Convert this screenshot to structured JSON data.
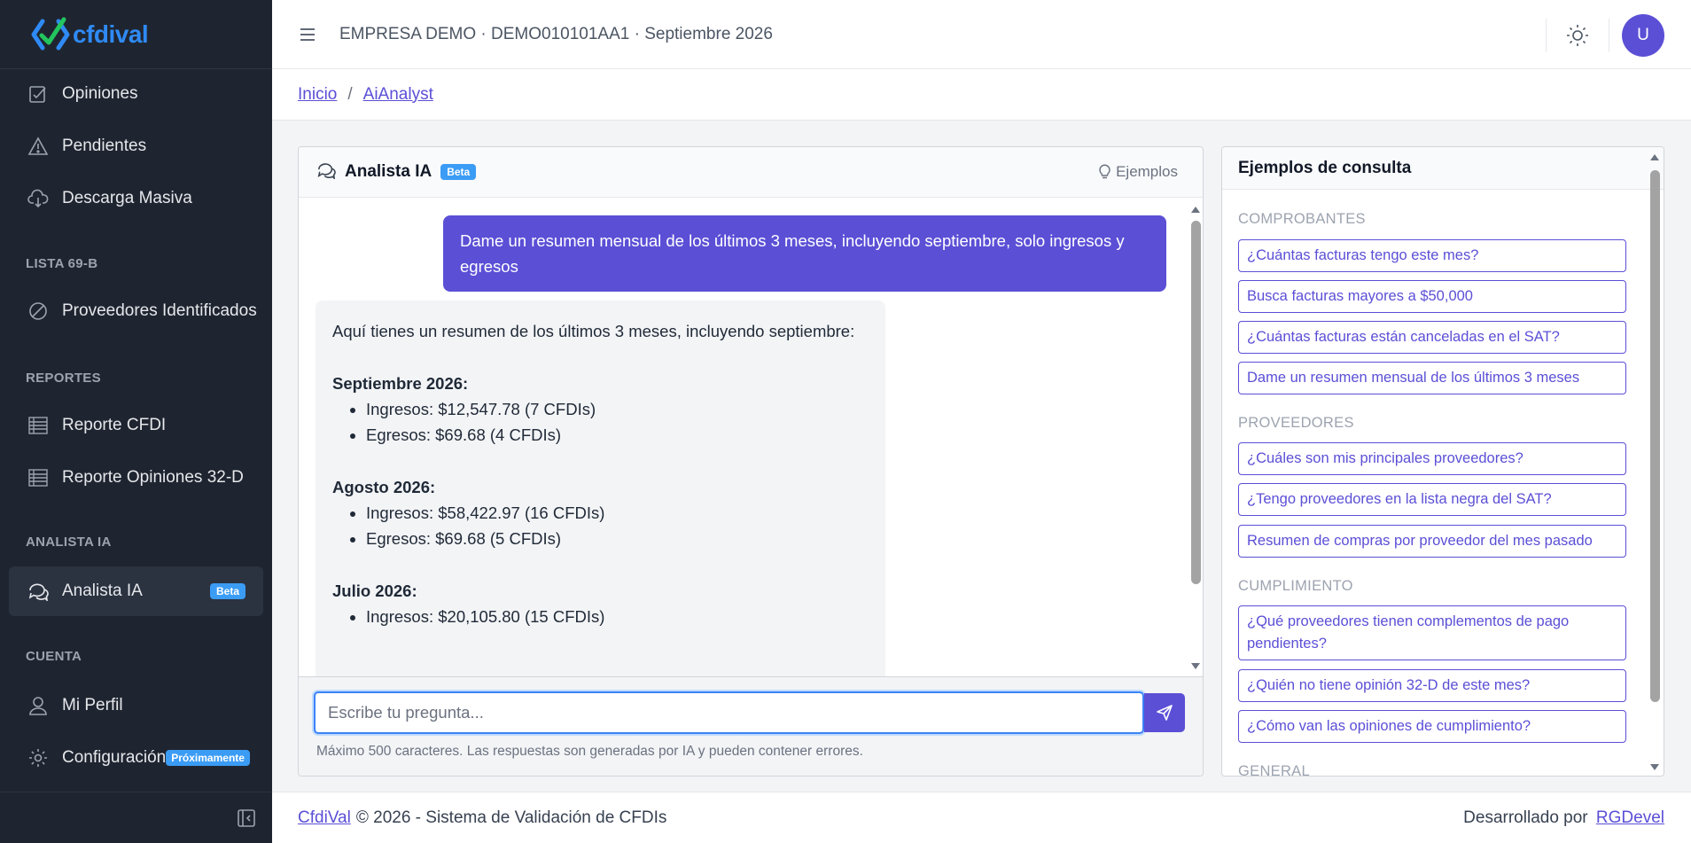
{
  "app": {
    "logo_text": "cfdival"
  },
  "header": {
    "company_context": "EMPRESA DEMO · DEMO010101AA1 · Septiembre 2026",
    "avatar_initial": "U"
  },
  "breadcrumb": {
    "home": "Inicio",
    "current": "AiAnalyst"
  },
  "sidebar": {
    "items_top": [
      {
        "label": "Opiniones",
        "icon": "clipboard-check-icon"
      },
      {
        "label": "Pendientes",
        "icon": "warning-triangle-icon"
      },
      {
        "label": "Descarga Masiva",
        "icon": "cloud-download-icon"
      }
    ],
    "section_lista": "LISTA 69-B",
    "item_proveedores": "Proveedores Identificados",
    "section_reportes": "REPORTES",
    "item_reporte_cfdi": "Reporte CFDI",
    "item_reporte_opiniones": "Reporte Opiniones 32-D",
    "section_analista": "ANALISTA IA",
    "item_analista": "Analista IA",
    "item_analista_badge": "Beta",
    "section_cuenta": "CUENTA",
    "item_perfil": "Mi Perfil",
    "item_config": "Configuración",
    "item_config_badge": "Próximamente"
  },
  "chat": {
    "title": "Analista IA",
    "badge": "Beta",
    "examples_link": "Ejemplos",
    "user_message": "Dame un resumen mensual de los últimos 3 meses, incluyendo septiembre, solo ingresos y egresos",
    "ai_intro": "Aquí tienes un resumen de los últimos 3 meses, incluyendo septiembre:",
    "ai_months": [
      {
        "title": "Septiembre 2026:",
        "lines": [
          "Ingresos: $12,547.78 (7 CFDIs)",
          "Egresos: $69.68 (4 CFDIs)"
        ]
      },
      {
        "title": "Agosto 2026:",
        "lines": [
          "Ingresos: $58,422.97 (16 CFDIs)",
          "Egresos: $69.68 (5 CFDIs)"
        ]
      },
      {
        "title": "Julio 2026:",
        "lines": [
          "Ingresos: $20,105.80 (15 CFDIs)"
        ]
      }
    ],
    "input_placeholder": "Escribe tu pregunta...",
    "hint": "Máximo 500 caracteres. Las respuestas son generadas por IA y pueden contener errores."
  },
  "examples": {
    "title": "Ejemplos de consulta",
    "sec_comprobantes": "COMPROBANTES",
    "comprobantes": [
      "¿Cuántas facturas tengo este mes?",
      "Busca facturas mayores a $50,000",
      "¿Cuántas facturas están canceladas en el SAT?",
      "Dame un resumen mensual de los últimos 3 meses"
    ],
    "sec_proveedores": "PROVEEDORES",
    "proveedores": [
      "¿Cuáles son mis principales proveedores?",
      "¿Tengo proveedores en la lista negra del SAT?",
      "Resumen de compras por proveedor del mes pasado"
    ],
    "sec_cumplimiento": "CUMPLIMIENTO",
    "cumplimiento": [
      "¿Qué proveedores tienen complementos de pago pendientes?",
      "¿Quién no tiene opinión 32-D de este mes?",
      "¿Cómo van las opiniones de cumplimiento?"
    ],
    "sec_general": "GENERAL"
  },
  "footer": {
    "brand": "CfdiVal",
    "copyright": "© 2026 - Sistema de Validación de CFDIs",
    "developed_by": "Desarrollado por",
    "developer": "RGDevel"
  },
  "colors": {
    "accent": "#5b4fd6",
    "sidebar_bg": "#1f2530",
    "badge": "#3b9cf5",
    "logo_blue": "#2f8af5",
    "logo_green": "#22c55e"
  }
}
